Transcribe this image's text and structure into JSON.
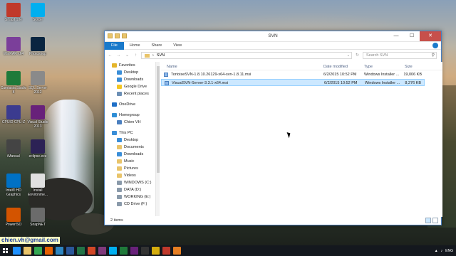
{
  "desktop": {
    "icons": [
      {
        "label": "Snagit 10e",
        "name": "snagit-icon",
        "color": "#c0392b"
      },
      {
        "label": "Skype",
        "name": "skype-icon",
        "color": "#00aff0"
      },
      {
        "label": "WinRAR x64",
        "name": "winrar-icon",
        "color": "#7b3f9a"
      },
      {
        "label": "Photoshop",
        "name": "photoshop-icon",
        "color": "#0a2540"
      },
      {
        "label": "Camtasia Studio 8",
        "name": "camtasia-icon",
        "color": "#1f7a3a"
      },
      {
        "label": "SQL Server 2012",
        "name": "sql-server-icon",
        "color": "#8a8a8a"
      },
      {
        "label": "CPUID CPU-Z",
        "name": "cpuz-icon",
        "color": "#3b3b8f"
      },
      {
        "label": "Visual Studio 2013",
        "name": "visual-studio-icon",
        "color": "#68217a"
      },
      {
        "label": "iManual",
        "name": "imanual-icon",
        "color": "#444"
      },
      {
        "label": "eclipse.exe",
        "name": "eclipse-icon",
        "color": "#2c2255"
      },
      {
        "label": "Intel® HD Graphics",
        "name": "intel-graphics-icon",
        "color": "#0071c5"
      },
      {
        "label": "Install Environme...",
        "name": "install-icon",
        "color": "#e0e0e0"
      },
      {
        "label": "PowerISO",
        "name": "poweriso-icon",
        "color": "#d35400"
      },
      {
        "label": "SnapNET",
        "name": "snapnet-icon",
        "color": "#6b6b6b"
      }
    ],
    "email": "chien.vh@gmail.com"
  },
  "window": {
    "title": "SVN",
    "ribbon_tabs": [
      "File",
      "Home",
      "Share",
      "View"
    ],
    "nav_buttons": {
      "back": "←",
      "forward": "→",
      "up": "↑"
    },
    "address": "SVN",
    "search_placeholder": "Search SVN",
    "navpane": [
      {
        "label": "Favorites",
        "icon": "star-icon",
        "color": "#e5b52a",
        "group": true
      },
      {
        "label": "Desktop",
        "icon": "desktop-icon",
        "color": "#3a8ed8"
      },
      {
        "label": "Downloads",
        "icon": "downloads-icon",
        "color": "#3a8ed8"
      },
      {
        "label": "Google Drive",
        "icon": "google-drive-icon",
        "color": "#f3c623"
      },
      {
        "label": "Recent places",
        "icon": "recent-icon",
        "color": "#6c8fb5"
      },
      {
        "label": "OneDrive",
        "icon": "onedrive-icon",
        "color": "#1e6fc7",
        "group": true
      },
      {
        "label": "Homegroup",
        "icon": "homegroup-icon",
        "color": "#2e8ed6",
        "group": true
      },
      {
        "label": "Chien VH",
        "icon": "user-icon",
        "color": "#4a7fbf"
      },
      {
        "label": "This PC",
        "icon": "pc-icon",
        "color": "#3a8ed8",
        "group": true
      },
      {
        "label": "Desktop",
        "icon": "desktop-icon",
        "color": "#3a8ed8"
      },
      {
        "label": "Documents",
        "icon": "documents-icon",
        "color": "#e9c46a"
      },
      {
        "label": "Downloads",
        "icon": "downloads-icon",
        "color": "#3a8ed8"
      },
      {
        "label": "Music",
        "icon": "music-icon",
        "color": "#e9c46a"
      },
      {
        "label": "Pictures",
        "icon": "pictures-icon",
        "color": "#e9c46a"
      },
      {
        "label": "Videos",
        "icon": "videos-icon",
        "color": "#e9c46a"
      },
      {
        "label": "WINDOWS (C:)",
        "icon": "drive-icon",
        "color": "#8a9aaa"
      },
      {
        "label": "DATA (D:)",
        "icon": "drive-icon",
        "color": "#8a9aaa"
      },
      {
        "label": "WORKING (E:)",
        "icon": "drive-icon",
        "color": "#8a9aaa"
      },
      {
        "label": "CD Drive (F:)",
        "icon": "drive-icon",
        "color": "#8a9aaa"
      }
    ],
    "columns": [
      "Name",
      "Date modified",
      "Type",
      "Size"
    ],
    "files": [
      {
        "name": "TortoiseSVN-1.8.10.26129-x64-svn-1.8.11.msi",
        "date": "6/2/2015 10:52 PM",
        "type": "Windows Installer ...",
        "size": "19,006 KB",
        "selected": false
      },
      {
        "name": "VisualSVN-Server-3.3.1-x64.msi",
        "date": "6/2/2015 10:52 PM",
        "type": "Windows Installer ...",
        "size": "8,276 KB",
        "selected": true
      }
    ],
    "status": "2 items"
  },
  "taskbar": {
    "apps": [
      {
        "name": "ie-icon",
        "color": "#1e90ff"
      },
      {
        "name": "explorer-icon",
        "color": "#e9c46a"
      },
      {
        "name": "chrome-icon",
        "color": "#34a853"
      },
      {
        "name": "firefox-icon",
        "color": "#e66000"
      },
      {
        "name": "store-icon",
        "color": "#2e86c1"
      },
      {
        "name": "word-icon",
        "color": "#2b579a"
      },
      {
        "name": "excel-icon",
        "color": "#217346"
      },
      {
        "name": "powerpoint-icon",
        "color": "#d24726"
      },
      {
        "name": "onenote-icon",
        "color": "#80397b"
      },
      {
        "name": "skype-icon",
        "color": "#00aff0"
      },
      {
        "name": "camtasia-icon",
        "color": "#1f7a3a"
      },
      {
        "name": "vs-icon",
        "color": "#68217a"
      },
      {
        "name": "cmd-icon",
        "color": "#333"
      },
      {
        "name": "paint-icon",
        "color": "#d4ac0d"
      },
      {
        "name": "snagit-icon",
        "color": "#c0392b"
      },
      {
        "name": "media-icon",
        "color": "#e67e22"
      }
    ],
    "lang": "ENG"
  }
}
